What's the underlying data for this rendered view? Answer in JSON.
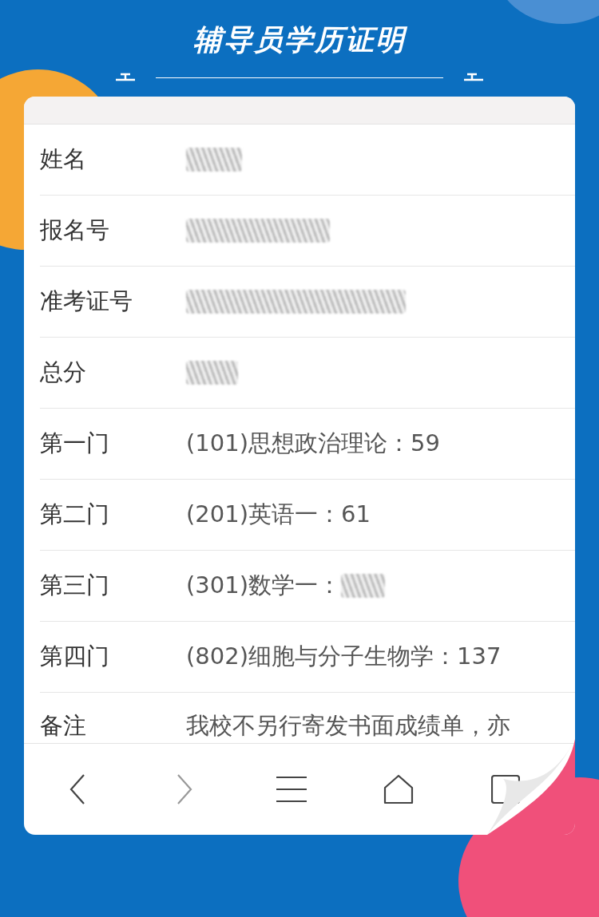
{
  "title": "辅导员学历证明",
  "rows": [
    {
      "label": "姓名",
      "redacted": true
    },
    {
      "label": "报名号",
      "redacted": true
    },
    {
      "label": "准考证号",
      "redacted": true
    },
    {
      "label": "总分",
      "redacted": true
    },
    {
      "label": "第一门",
      "value": "(101)思想政治理论：59",
      "redacted": false
    },
    {
      "label": "第二门",
      "value": "(201)英语一：61",
      "redacted": false
    },
    {
      "label": "第三门",
      "value": "(301)数学一：",
      "redacted": true
    },
    {
      "label": "第四门",
      "value": "(802)细胞与分子生物学：137",
      "redacted": false
    },
    {
      "label": "备注",
      "value": "我校不另行寄发书面成绩单，亦",
      "redacted": false
    }
  ],
  "nav": [
    {
      "kind": "back",
      "disabled": false
    },
    {
      "kind": "forward",
      "disabled": true
    },
    {
      "kind": "menu",
      "disabled": false
    },
    {
      "kind": "home",
      "disabled": false
    },
    {
      "kind": "tabs",
      "disabled": false
    }
  ]
}
